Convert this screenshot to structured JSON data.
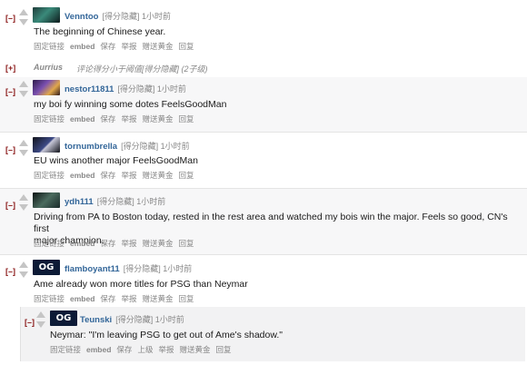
{
  "actions": {
    "permalink": "固定链接",
    "embed": "embed",
    "save": "保存",
    "report": "举报",
    "give_gold": "赠送黄金",
    "reply": "回复",
    "parent": "上级"
  },
  "toggle_open": "[–]",
  "toggle_collapsed": "[+]",
  "comments": [
    {
      "author": "Venntoo",
      "meta": "[得分隐藏] 1小时前",
      "text": "The beginning of Chinese year."
    },
    {
      "author": "nestor11811",
      "meta": "[得分隐藏] 1小时前",
      "text": "my boi fy winning some dotes FeelsGoodMan"
    },
    {
      "author": "tornumbrella",
      "meta": "[得分隐藏] 1小时前",
      "text": "EU wins another major FeelsGoodMan"
    },
    {
      "author": "ydh111",
      "meta": "[得分隐藏] 1小时前",
      "text_line1": "Driving from PA to Boston today, rested in the rest area and watched my bois win the major. Feels so good, CN's first",
      "text_line2": "major champion."
    },
    {
      "author": "flamboyant11",
      "meta": "[得分隐藏] 1小时前",
      "text": "Ame already won more titles for PSG than Neymar"
    }
  ],
  "collapsed": {
    "author": "Aurrius",
    "meta": "评论得分小于阈值[得分隐藏] (2子级)"
  },
  "reply": {
    "author": "Teunski",
    "meta": "[得分隐藏] 1小时前",
    "text": "Neymar: \"I'm leaving PSG to get out of Ame's shadow.\""
  },
  "avatar_labels": {
    "og": "OG"
  }
}
